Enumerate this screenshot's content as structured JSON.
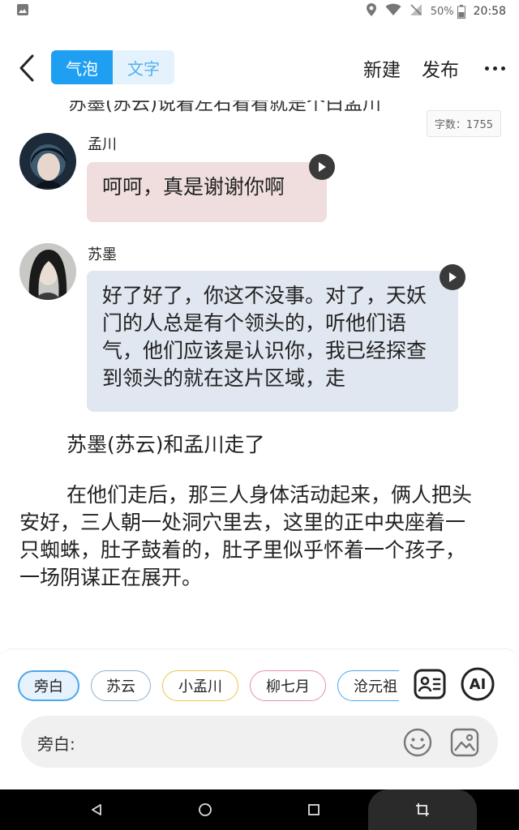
{
  "status_bar": {
    "battery": "50%",
    "time": "20:58"
  },
  "header": {
    "mode_tabs": [
      {
        "label": "气泡",
        "active": true
      },
      {
        "label": "文字",
        "active": false
      }
    ],
    "new_label": "新建",
    "publish_label": "发布"
  },
  "content": {
    "cut_off_line": "苏墨(苏云)说着左右看看就是个白孟川",
    "word_count": "字数：1755",
    "messages": [
      {
        "speaker": "孟川",
        "text": "呵呵，真是谢谢你啊",
        "bubble_color": "#f0dede"
      },
      {
        "speaker": "苏墨",
        "text": "好了好了，你这不没事。对了，天妖门的人总是有个领头的，听他们语气，他们应该是认识你，我已经探查到领头的就在这片区域，走",
        "bubble_color": "#e0e7f0"
      }
    ],
    "narrations": [
      "苏墨(苏云)和孟川走了",
      "在他们走后，那三人身体活动起来，俩人把头安好，三人朝一处洞穴里去，这里的正中央座着一只蜘蛛，肚子鼓着的，肚子里似乎怀着一个孩子，一场阴谋正在展开。"
    ]
  },
  "editor": {
    "roles": [
      {
        "label": "旁白",
        "selected": true,
        "color": "#4aa7ec"
      },
      {
        "label": "苏云",
        "selected": false,
        "color": "#8fb0cf"
      },
      {
        "label": "小孟川",
        "selected": false,
        "color": "#e9c54a"
      },
      {
        "label": "柳七月",
        "selected": false,
        "color": "#e58fb0"
      },
      {
        "label": "沧元祖",
        "selected": false,
        "color": "#4aa7ec"
      }
    ],
    "ai_label": "AI",
    "input_label": "旁白:",
    "input_value": ""
  },
  "colors": {
    "accent": "#1e9ff2",
    "accent_light": "#e4f2fd"
  }
}
